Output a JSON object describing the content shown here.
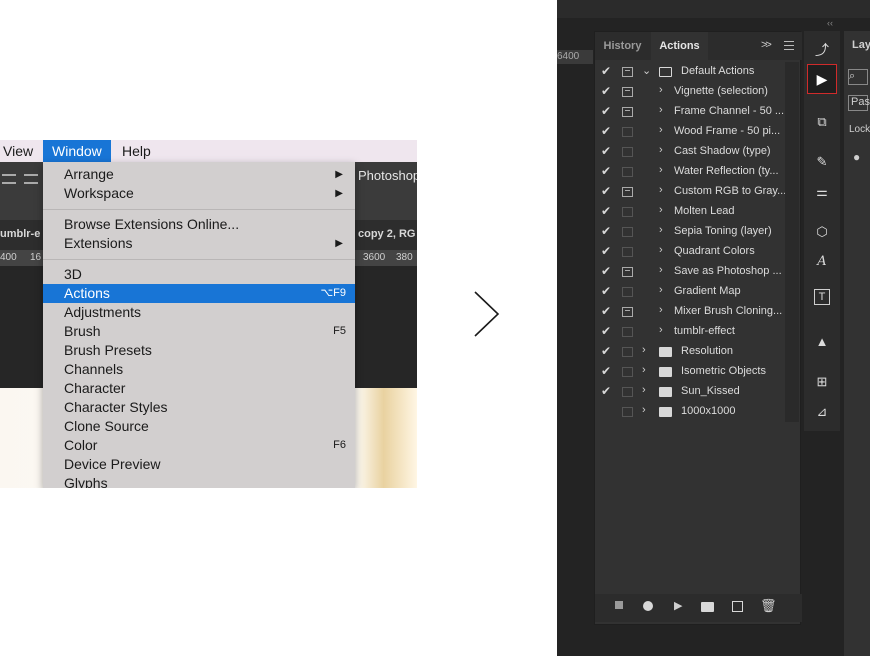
{
  "menubar": {
    "view": "View",
    "window": "Window",
    "help": "Help"
  },
  "app_bg_text": {
    "photoshop": "Photoshop",
    "tab_left": "umblr-e",
    "tab_right": "copy 2, RG",
    "ruler_labels": [
      "400",
      "16",
      "3600",
      "380"
    ]
  },
  "window_menu": {
    "items": [
      {
        "label": "Arrange",
        "submenu": true
      },
      {
        "label": "Workspace",
        "submenu": true
      },
      {
        "label": "Browse Extensions Online...",
        "submenu": false
      },
      {
        "label": "Extensions",
        "submenu": true
      },
      {
        "label": "3D",
        "submenu": false
      },
      {
        "label": "Actions",
        "shortcut": "⌥F9",
        "selected": true
      },
      {
        "label": "Adjustments"
      },
      {
        "label": "Brush",
        "shortcut": "F5"
      },
      {
        "label": "Brush Presets"
      },
      {
        "label": "Channels"
      },
      {
        "label": "Character"
      },
      {
        "label": "Character Styles"
      },
      {
        "label": "Clone Source"
      },
      {
        "label": "Color",
        "shortcut": "F6"
      },
      {
        "label": "Device Preview"
      },
      {
        "label": "Glyphs"
      }
    ]
  },
  "panel": {
    "tabs": [
      "History",
      "Actions"
    ],
    "more": ">>",
    "ruler_label": "6400",
    "actions": [
      {
        "label": "Default Actions",
        "type": "set",
        "open": true,
        "checked": true,
        "dialog": true
      },
      {
        "label": "Vignette (selection)",
        "checked": true,
        "dialog": true
      },
      {
        "label": "Frame Channel - 50 ...",
        "checked": true,
        "dialog": true
      },
      {
        "label": "Wood Frame - 50 pi...",
        "checked": true,
        "dialog": false
      },
      {
        "label": "Cast Shadow (type)",
        "checked": true,
        "dialog": false
      },
      {
        "label": "Water Reflection (ty...",
        "checked": true,
        "dialog": false
      },
      {
        "label": "Custom RGB to Gray...",
        "checked": true,
        "dialog": true
      },
      {
        "label": "Molten Lead",
        "checked": true,
        "dialog": false
      },
      {
        "label": "Sepia Toning (layer)",
        "checked": true,
        "dialog": false
      },
      {
        "label": "Quadrant Colors",
        "checked": true,
        "dialog": false
      },
      {
        "label": "Save as Photoshop ...",
        "checked": true,
        "dialog": true
      },
      {
        "label": "Gradient Map",
        "checked": true,
        "dialog": false
      },
      {
        "label": "Mixer Brush Cloning...",
        "checked": true,
        "dialog": true
      },
      {
        "label": "tumblr-effect",
        "checked": true,
        "dialog": false
      },
      {
        "label": "Resolution",
        "type": "set",
        "checked": true,
        "dialog": false
      },
      {
        "label": "Isometric Objects",
        "type": "set",
        "checked": true,
        "dialog": false
      },
      {
        "label": "Sun_Kissed",
        "type": "set",
        "checked": true,
        "dialog": false
      },
      {
        "label": "1000x1000",
        "type": "set",
        "checked": false,
        "dialog": false
      }
    ],
    "footer_icons": [
      "stop-icon",
      "record-icon",
      "play-icon",
      "folder-icon",
      "new-action-icon",
      "trash-icon"
    ]
  },
  "layers_panel": {
    "title": "Lay",
    "blend": "Pas",
    "lock": "Lock"
  },
  "colors": {
    "menu_highlight": "#1875d6",
    "play_border": "#d02b2b"
  }
}
